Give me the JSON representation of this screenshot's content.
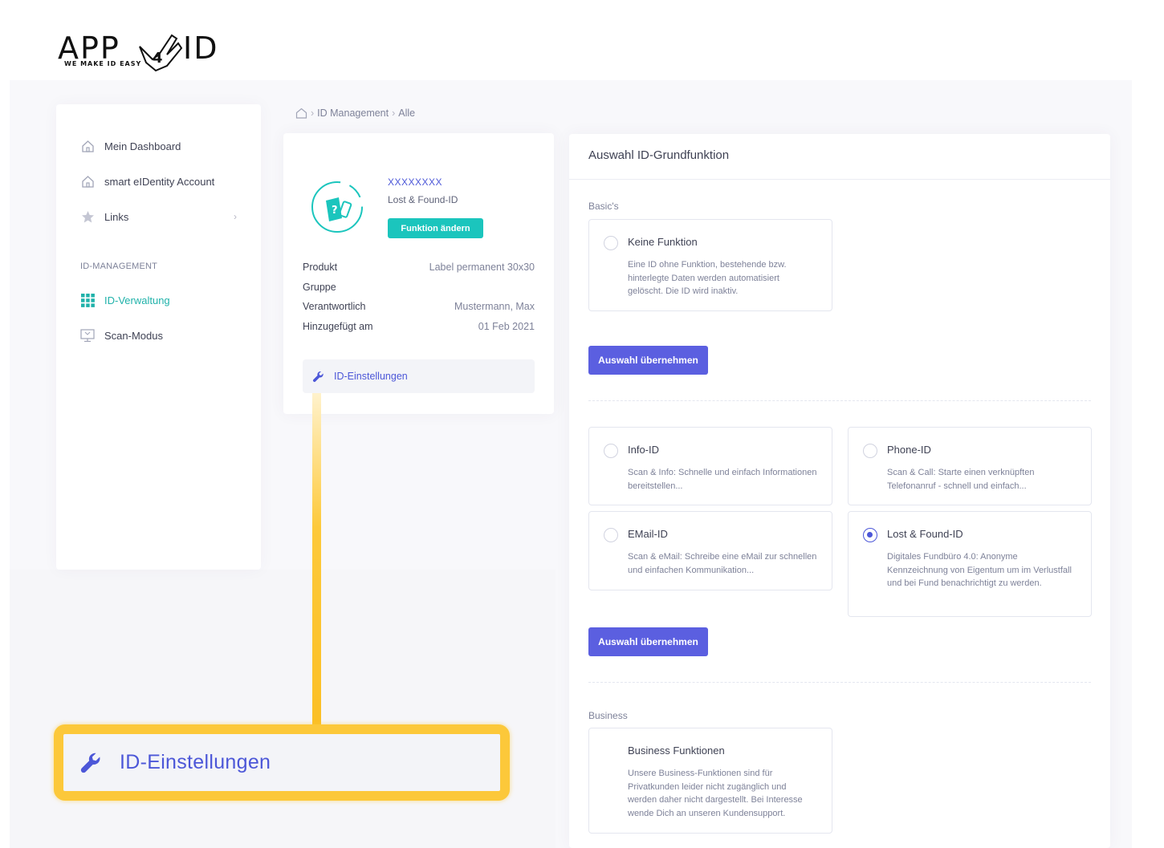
{
  "logo": {
    "text_a": "APP",
    "text_b": "ID",
    "tagline": "WE MAKE ID EASY"
  },
  "sidebar": {
    "items": [
      {
        "label": "Mein Dashboard",
        "icon": "home-icon"
      },
      {
        "label": "smart eIDentity Account",
        "icon": "home-icon"
      },
      {
        "label": "Links",
        "icon": "star-icon",
        "chevron": "›"
      }
    ],
    "section_title": "ID-MANAGEMENT",
    "section_items": [
      {
        "label": "ID-Verwaltung",
        "icon": "grid-icon",
        "active": true
      },
      {
        "label": "Scan-Modus",
        "icon": "monitor-icon",
        "active": false
      }
    ]
  },
  "breadcrumb": {
    "sep1": "›",
    "item1": "ID Management",
    "sep2": "›",
    "item2": "Alle"
  },
  "info_card": {
    "id_title": "XXXXXXXX",
    "id_type": "Lost & Found-ID",
    "change_button": "Funktion ändern",
    "rows": [
      {
        "key": "Produkt",
        "value": "Label permanent 30x30"
      },
      {
        "key": "Gruppe",
        "value": ""
      },
      {
        "key": "Verantwortlich",
        "value": "Mustermann, Max"
      },
      {
        "key": "Hinzugefügt am",
        "value": "01 Feb 2021"
      }
    ],
    "settings_label": "ID-Einstellungen"
  },
  "right_card": {
    "header": "Auswahl ID-Grundfunktion",
    "basics_label": "Basic's",
    "keine": {
      "title": "Keine Funktion",
      "desc": "Eine ID ohne Funktion, bestehende bzw. hinterlegte Daten werden automatisiert gelöscht. Die ID wird inaktiv."
    },
    "apply_button_1": "Auswahl übernehmen",
    "info": {
      "title": "Info-ID",
      "desc": "Scan & Info: Schnelle und einfach Informationen bereitstellen..."
    },
    "phone": {
      "title": "Phone-ID",
      "desc": "Scan & Call: Starte einen verknüpften Telefonanruf - schnell und einfach..."
    },
    "email": {
      "title": "EMail-ID",
      "desc": "Scan & eMail: Schreibe eine eMail zur schnellen und einfachen Kommunikation..."
    },
    "lostfound": {
      "title": "Lost & Found-ID",
      "desc": "Digitales Fundbüro 4.0: Anonyme Kennzeichnung von Eigentum um im Verlustfall und bei Fund benachrichtigt zu werden.",
      "selected": true
    },
    "apply_button_2": "Auswahl übernehmen",
    "business_label": "Business",
    "business": {
      "title": "Business Funktionen",
      "desc": "Unsere Business-Funktionen sind für Privatkunden leider nicht zugänglich und werden daher nicht dargestellt. Bei Interesse wende Dich an unseren Kundensupport."
    }
  },
  "callout": {
    "label": "ID-Einstellungen"
  },
  "colors": {
    "primary": "#5b5fe0",
    "teal": "#1bc5bd",
    "highlight": "#fcc83a",
    "link": "#4c57d8"
  }
}
